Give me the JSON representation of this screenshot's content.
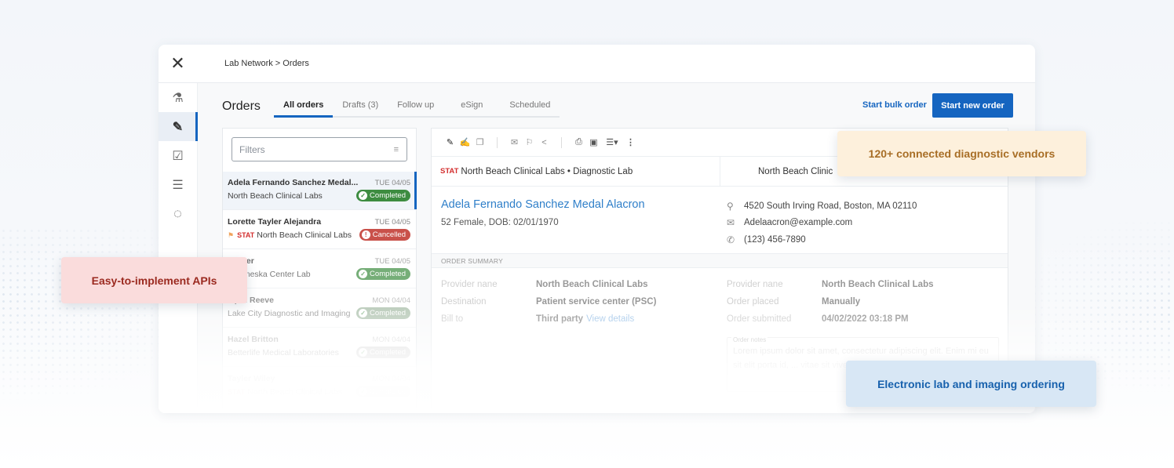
{
  "window": {
    "breadcrumb": "Lab Network > Orders"
  },
  "rail": {
    "items": [
      {
        "icon": "lab-flask-icon",
        "glyph": "⚗",
        "active": false
      },
      {
        "icon": "order-edit-icon",
        "glyph": "✎",
        "active": true
      },
      {
        "icon": "checklist-icon",
        "glyph": "☑",
        "active": false
      },
      {
        "icon": "sliders-icon",
        "glyph": "☰",
        "active": false
      },
      {
        "icon": "progress-ring-icon",
        "glyph": "◌",
        "active": false
      }
    ]
  },
  "header": {
    "title": "Orders",
    "tabs": [
      {
        "label": "All orders",
        "active": true
      },
      {
        "label": "Drafts (3)",
        "active": false
      },
      {
        "label": "Follow up",
        "active": false
      },
      {
        "label": "eSign",
        "active": false
      },
      {
        "label": "Scheduled",
        "active": false
      }
    ],
    "bulk_order_label": "Start bulk order",
    "new_order_label": "Start new order"
  },
  "list": {
    "filter_placeholder": "Filters",
    "orders": [
      {
        "name": "Adela Fernando Sanchez Medal...",
        "date": "TUE 04/05",
        "lab": "North Beach Clinical Labs",
        "status": "Completed",
        "stat": false,
        "selected": true
      },
      {
        "name": "Lorette Tayler Alejandra",
        "date": "TUE 04/05",
        "lab": "North Beach Clinical Labs",
        "status": "Cancelled",
        "stat": true,
        "stat_label": "STAT",
        "selected": false
      },
      {
        "name": "...ester",
        "date": "TUE 04/05",
        "lab": "...Jameska Center Lab",
        "status": "Completed",
        "stat": false,
        "selected": false
      },
      {
        "name": "...pril Reeve",
        "date": "MON 04/04",
        "lab": "Lake City Diagnostic and Imaging",
        "status": "Completed",
        "stat": false,
        "selected": false
      },
      {
        "name": "Hazel Britton",
        "date": "MON 04/04",
        "lab": "Betterlife Medical Laboratories",
        "status": "Completed",
        "stat": false,
        "selected": false
      },
      {
        "name": "Tayler Wiley",
        "date": "MON 04/04",
        "lab": "North Beach Clinical Labs",
        "status": "Completed",
        "stat": true,
        "stat_label": "STAT",
        "selected": false
      }
    ]
  },
  "detail": {
    "toolbar_icons": [
      "pencil-icon",
      "sign-icon",
      "copy-icon",
      "mail-icon",
      "flag-icon",
      "share-icon",
      "print-icon",
      "pdf-icon",
      "layout-dropdown-icon",
      "more-vert-icon"
    ],
    "stat_label": "STAT",
    "lab_primary": "North Beach Clinical Labs • Diagnostic Lab",
    "lab_secondary": "North Beach Clinic",
    "patient": {
      "name": "Adela Fernando Sanchez Medal Alacron",
      "meta": "52 Female, DOB: 02/01/1970",
      "address": "4520 South Irving Road, Boston, MA 02110",
      "email": "Adelaacron@example.com",
      "phone": "(123) 456-7890"
    },
    "summary_title": "ORDER SUMMARY",
    "summary_left": [
      {
        "label": "Provider nane",
        "value": "North Beach Clinical Labs"
      },
      {
        "label": "Destination",
        "value": "Patient service center (PSC)"
      },
      {
        "label": "Bill to",
        "value": "Third party",
        "link": "View details"
      }
    ],
    "summary_right": [
      {
        "label": "Provider nane",
        "value": "North Beach Clinical Labs"
      },
      {
        "label": "Order placed",
        "value": "Manually"
      },
      {
        "label": "Order submitted",
        "value": "04/02/2022 03:18 PM"
      }
    ],
    "notes_label": "Order notes",
    "notes_text": "Lorem ipsum dolor sit amet, consectetur adipiscing elit. Enim mi eu sit elit porta id, ... vitae sit viverra tristique ..."
  },
  "callouts": {
    "vendors": "120+ connected diagnostic vendors",
    "apis": "Easy-to-implement APIs",
    "ordering": "Electronic lab and imaging ordering"
  },
  "colors": {
    "primary": "#1565c0",
    "completed": "#3d8c40",
    "cancelled": "#c9514a",
    "stat": "#d32f2f"
  }
}
